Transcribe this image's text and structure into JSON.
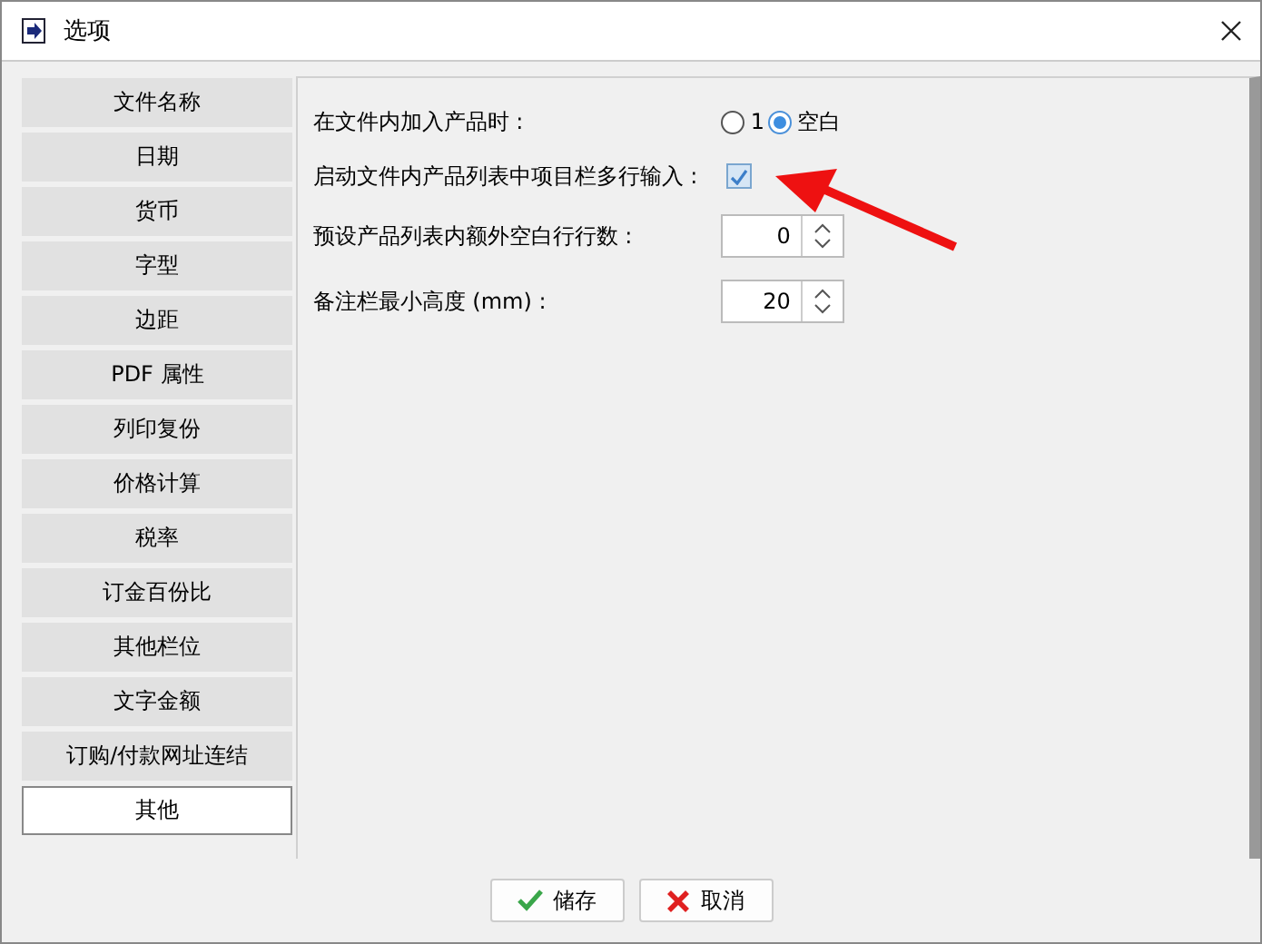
{
  "window": {
    "title": "选项"
  },
  "sidebar": {
    "items": [
      {
        "label": "文件名称",
        "selected": false
      },
      {
        "label": "日期",
        "selected": false
      },
      {
        "label": "货币",
        "selected": false
      },
      {
        "label": "字型",
        "selected": false
      },
      {
        "label": "边距",
        "selected": false
      },
      {
        "label": "PDF 属性",
        "selected": false
      },
      {
        "label": "列印复份",
        "selected": false
      },
      {
        "label": "价格计算",
        "selected": false
      },
      {
        "label": "税率",
        "selected": false
      },
      {
        "label": "订金百份比",
        "selected": false
      },
      {
        "label": "其他栏位",
        "selected": false
      },
      {
        "label": "文字金额",
        "selected": false
      },
      {
        "label": "订购/付款网址连结",
        "selected": false
      },
      {
        "label": "其他",
        "selected": true
      }
    ]
  },
  "settings": [
    {
      "kind": "radio",
      "label": "在文件内加入产品时 :",
      "options": [
        {
          "label": "1",
          "selected": false
        },
        {
          "label": "空白",
          "selected": true
        }
      ]
    },
    {
      "kind": "checkbox",
      "label": "启动文件内产品列表中项目栏多行输入 :",
      "checked": true
    },
    {
      "kind": "spinner",
      "label": "预设产品列表内额外空白行行数 :",
      "value": "0"
    },
    {
      "kind": "spinner",
      "label": "备注栏最小高度 (mm) :",
      "value": "20"
    }
  ],
  "buttons": [
    {
      "kind": "save",
      "label": "储存"
    },
    {
      "kind": "cancel",
      "label": "取消"
    }
  ]
}
